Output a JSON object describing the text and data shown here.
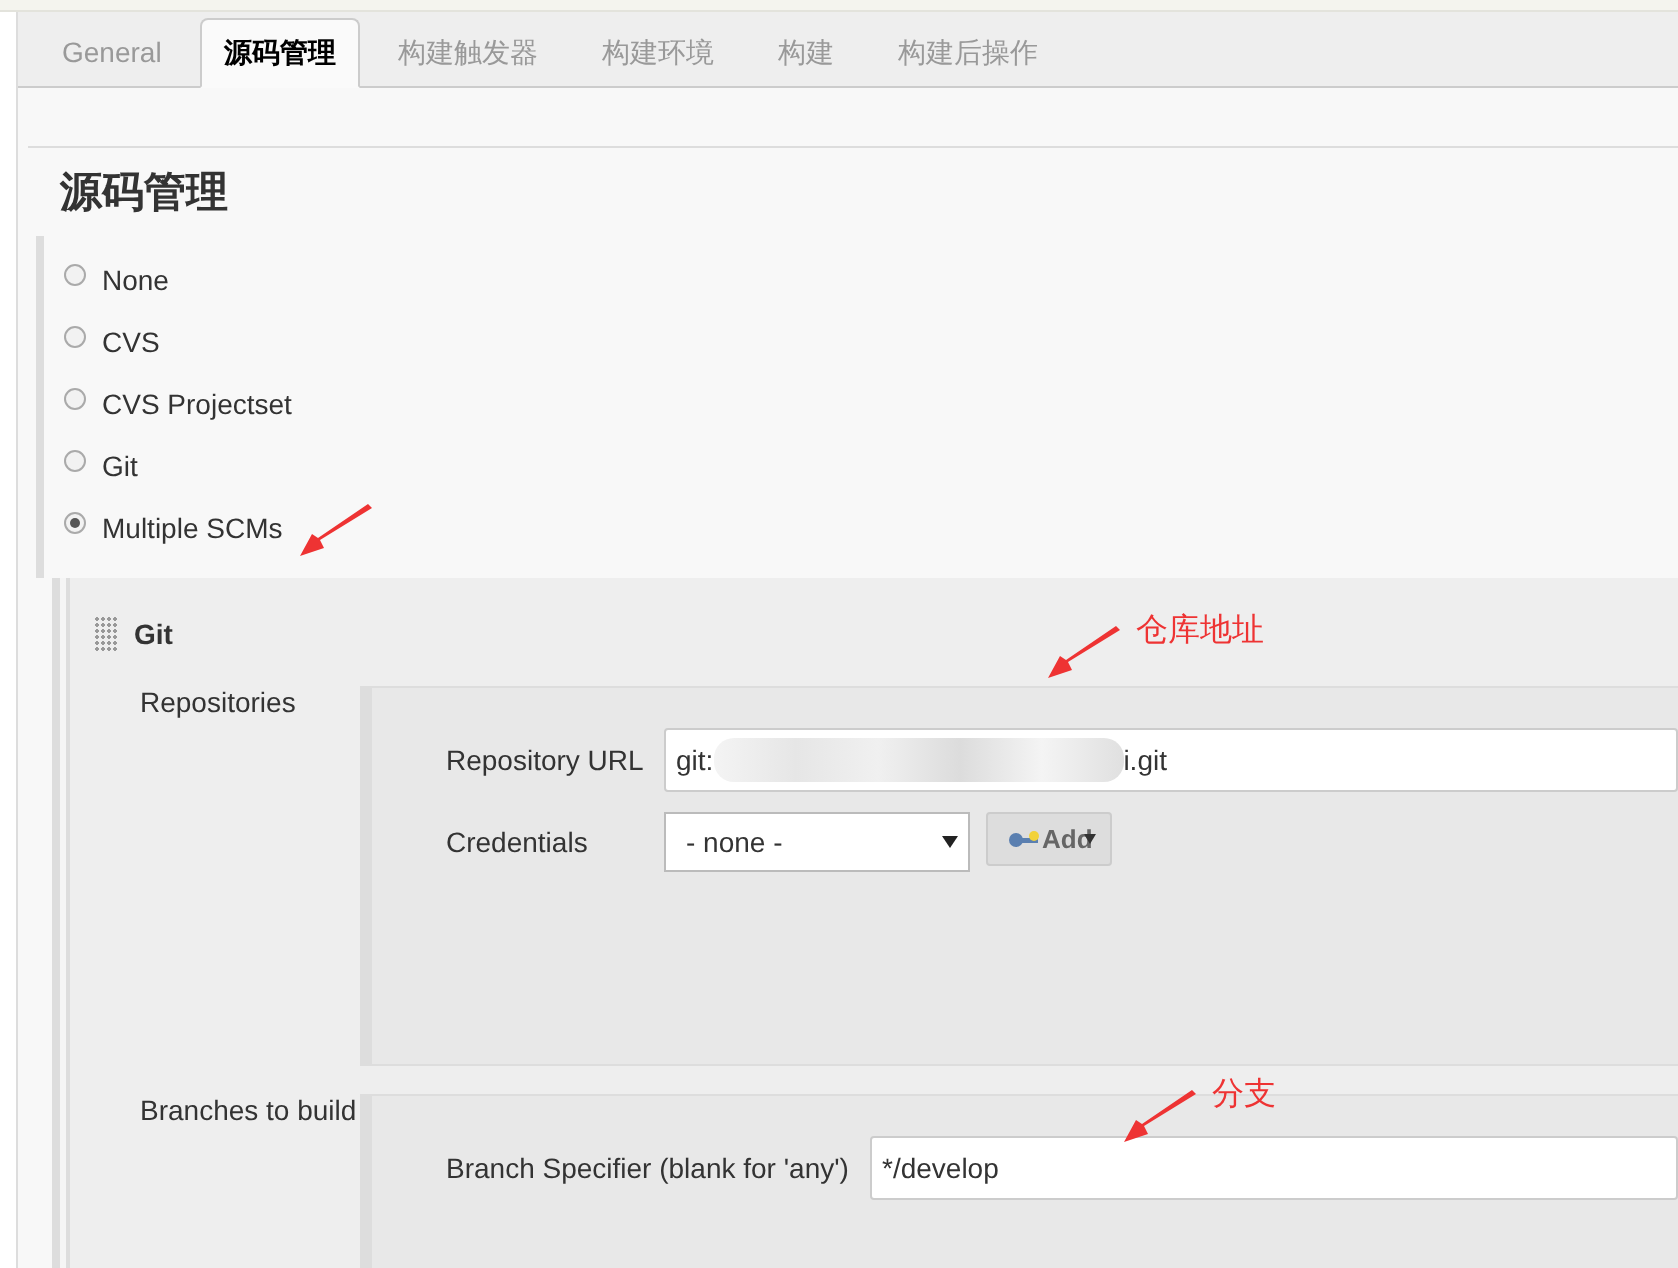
{
  "tabs": [
    {
      "label": "General",
      "selected": false
    },
    {
      "label": "源码管理",
      "selected": true
    },
    {
      "label": "构建触发器",
      "selected": false
    },
    {
      "label": "构建环境",
      "selected": false
    },
    {
      "label": "构建",
      "selected": false
    },
    {
      "label": "构建后操作",
      "selected": false
    }
  ],
  "section_title": "源码管理",
  "scm_options": [
    {
      "label": "None",
      "selected": false
    },
    {
      "label": "CVS",
      "selected": false
    },
    {
      "label": "CVS Projectset",
      "selected": false
    },
    {
      "label": "Git",
      "selected": false
    },
    {
      "label": "Multiple SCMs",
      "selected": true
    }
  ],
  "git": {
    "title": "Git",
    "repositories_label": "Repositories",
    "repository_url": {
      "label": "Repository URL",
      "value_start": "git:",
      "value_end": "i.git"
    },
    "credentials": {
      "label": "Credentials",
      "value": "- none -",
      "add_button": "Add"
    },
    "branches_label": "Branches to build",
    "branch_specifier": {
      "label": "Branch Specifier (blank for 'any')",
      "value": "*/develop"
    }
  },
  "annotations": [
    {
      "kind": "scm"
    },
    {
      "kind": "repo",
      "text": "仓库地址"
    },
    {
      "kind": "branch",
      "text": "分支"
    }
  ]
}
